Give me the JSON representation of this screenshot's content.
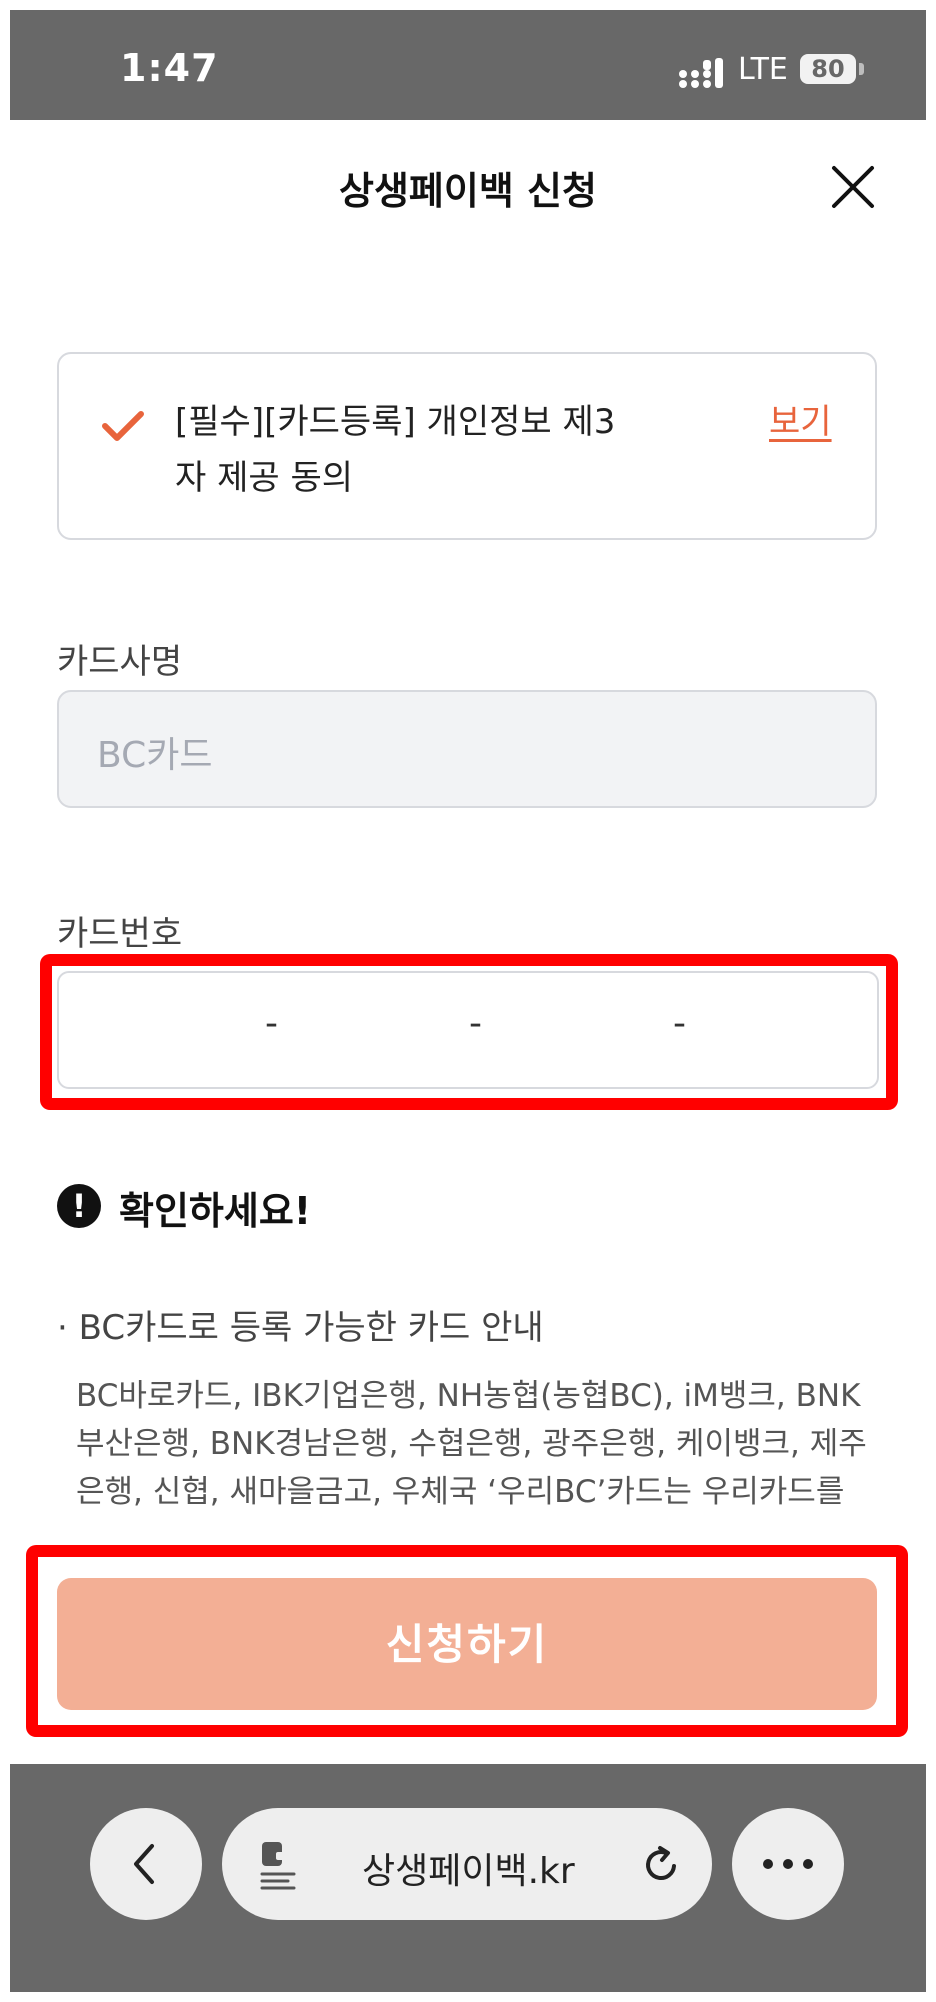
{
  "status_bar": {
    "time": "1:47",
    "network": "LTE",
    "battery": "80"
  },
  "header": {
    "title": "상생페이백 신청"
  },
  "consent": {
    "text": "[필수][카드등록] 개인정보 제3자 제공 동의",
    "view_link": "보기"
  },
  "card_company": {
    "label": "카드사명",
    "value": "BC카드"
  },
  "card_number": {
    "label": "카드번호",
    "separators": [
      "-",
      "-",
      "-"
    ]
  },
  "notice": {
    "title": "확인하세요!",
    "bullet_title": "· BC카드로 등록 가능한 카드 안내",
    "bullet_body": "BC바로카드, IBK기업은행, NH농협(농협BC), iM뱅크, BNK부산은행, BNK경남은행, 수협은행, 광주은행, 케이뱅크, 제주은행, 신협, 새마을금고, 우체국 ‘우리BC’카드는 우리카드를 통해 신청 가능합니다"
  },
  "apply_button": {
    "label": "신청하기"
  },
  "browser": {
    "url": "상생페이백.kr"
  },
  "colors": {
    "accent": "#e8643c",
    "apply_disabled": "#f3af95",
    "highlight": "#ff0000",
    "system_bar": "#686868"
  }
}
